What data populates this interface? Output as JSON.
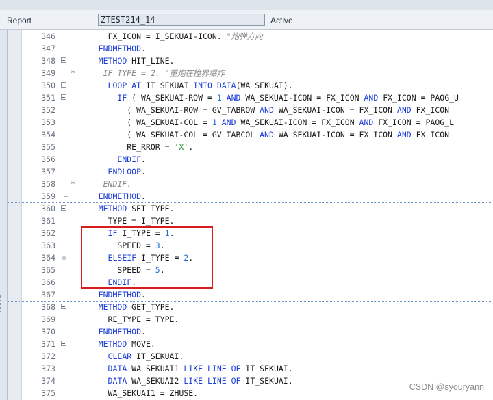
{
  "header": {
    "type_label": "Report",
    "program_name": "ZTEST214_14",
    "status": "Active"
  },
  "code_lines": [
    {
      "n": "346",
      "text": "      FX_ICON = I_SEKUAI-ICON. \"炮弹方向"
    },
    {
      "n": "347",
      "text": "    ENDMETHOD."
    },
    {
      "n": "348",
      "text": "    METHOD HIT_LINE."
    },
    {
      "n": "349",
      "text": "*     IF TYPE = 2. \"重炮在撞界爆炸"
    },
    {
      "n": "350",
      "text": "      LOOP AT IT_SEKUAI INTO DATA(WA_SEKUAI)."
    },
    {
      "n": "351",
      "text": "        IF ( WA_SEKUAI-ROW = 1 AND WA_SEKUAI-ICON = FX_ICON AND FX_ICON = PAOG_U"
    },
    {
      "n": "352",
      "text": "          ( WA_SEKUAI-ROW = GV_TABROW AND WA_SEKUAI-ICON = FX_ICON AND FX_ICON"
    },
    {
      "n": "353",
      "text": "          ( WA_SEKUAI-COL = 1 AND WA_SEKUAI-ICON = FX_ICON AND FX_ICON = PAOG_L"
    },
    {
      "n": "354",
      "text": "          ( WA_SEKUAI-COL = GV_TABCOL AND WA_SEKUAI-ICON = FX_ICON AND FX_ICON"
    },
    {
      "n": "355",
      "text": "          RE_RROR = 'X'."
    },
    {
      "n": "356",
      "text": "        ENDIF."
    },
    {
      "n": "357",
      "text": "      ENDLOOP."
    },
    {
      "n": "358",
      "text": "*     ENDIF."
    },
    {
      "n": "359",
      "text": "    ENDMETHOD."
    },
    {
      "n": "360",
      "text": "    METHOD SET_TYPE."
    },
    {
      "n": "361",
      "text": "      TYPE = I_TYPE."
    },
    {
      "n": "362",
      "text": "      IF I_TYPE = 1."
    },
    {
      "n": "363",
      "text": "        SPEED = 3."
    },
    {
      "n": "364",
      "text": "      ELSEIF I_TYPE = 2."
    },
    {
      "n": "365",
      "text": "        SPEED = 5."
    },
    {
      "n": "366",
      "text": "      ENDIF."
    },
    {
      "n": "367",
      "text": "    ENDMETHOD."
    },
    {
      "n": "368",
      "text": "    METHOD GET_TYPE."
    },
    {
      "n": "369",
      "text": "      RE_TYPE = TYPE."
    },
    {
      "n": "370",
      "text": "    ENDMETHOD."
    },
    {
      "n": "371",
      "text": "    METHOD MOVE."
    },
    {
      "n": "372",
      "text": "      CLEAR IT_SEKUAI."
    },
    {
      "n": "373",
      "text": "      DATA WA_SEKUAI1 LIKE LINE OF IT_SEKUAI."
    },
    {
      "n": "374",
      "text": "      DATA WA_SEKUAI2 LIKE LINE OF IT_SEKUAI."
    },
    {
      "n": "375",
      "text": "      WA_SEKUAI1 = ZHUSE."
    }
  ],
  "watermark": "CSDN @syouryann"
}
